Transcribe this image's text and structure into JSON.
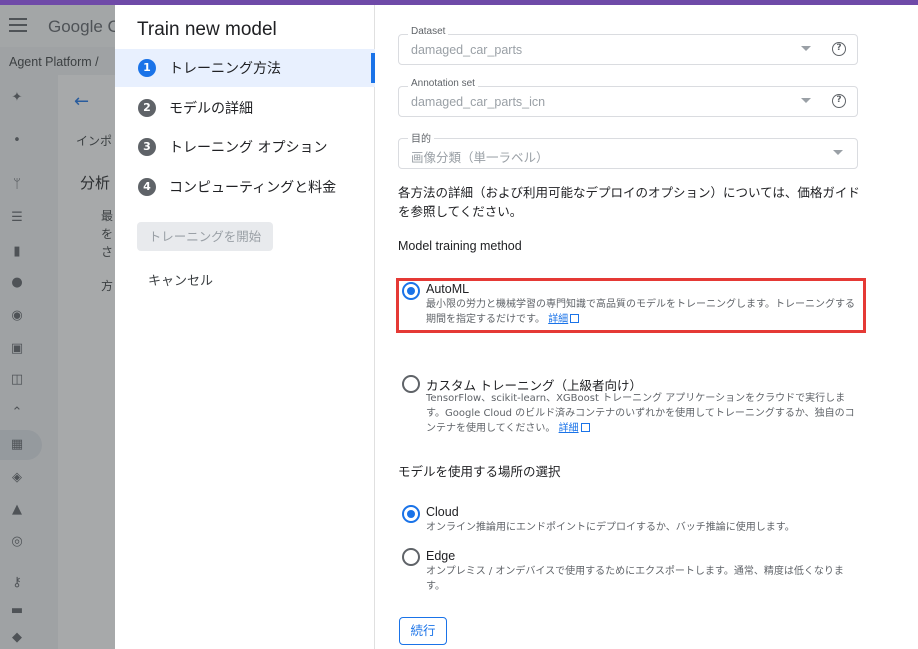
{
  "background": {
    "logo": "Google C",
    "breadcrumb": "Agent Platform  /",
    "tab_partial": "インポ",
    "title_partial": "分析",
    "text_partial": [
      "最",
      "を",
      "さ",
      "方"
    ]
  },
  "dialog": {
    "title": "Train new model",
    "steps": [
      {
        "num": "1",
        "label": "トレーニング方法"
      },
      {
        "num": "2",
        "label": "モデルの詳細"
      },
      {
        "num": "3",
        "label": "トレーニング オプション"
      },
      {
        "num": "4",
        "label": "コンピューティングと料金"
      }
    ],
    "start_label": "トレーニングを開始",
    "cancel_label": "キャンセル"
  },
  "form": {
    "dataset": {
      "label": "Dataset",
      "value": "damaged_car_parts"
    },
    "annotation": {
      "label": "Annotation set",
      "value": "damaged_car_parts_icn"
    },
    "objective": {
      "label": "目的",
      "value": "画像分類（単一ラベル）"
    },
    "description": "各方法の詳細（および利用可能なデプロイのオプション）については、価格ガイドを参照してください。",
    "method_heading": "Model training method",
    "automl": {
      "title": "AutoML",
      "desc": "最小限の労力と機械学習の専門知識で高品質のモデルをトレーニングします。トレーニングする期間を指定するだけです。",
      "link": "詳細"
    },
    "custom": {
      "title": "カスタム トレーニング（上級者向け）",
      "desc": "TensorFlow、scikit-learn、XGBoost トレーニング アプリケーションをクラウドで実行します。Google Cloud のビルド済みコンテナのいずれかを使用してトレーニングするか、独自のコンテナを使用してください。",
      "link": "詳細"
    },
    "location_heading": "モデルを使用する場所の選択",
    "cloud": {
      "title": "Cloud",
      "desc": "オンライン推論用にエンドポイントにデプロイするか、バッチ推論に使用します。"
    },
    "edge": {
      "title": "Edge",
      "desc": "オンプレミス / オンデバイスで使用するためにエクスポートします。通常、精度は低くなります。"
    },
    "continue_label": "続行"
  },
  "colors": {
    "accent": "#1a73e8",
    "highlight": "#e53935",
    "topbar": "#6f4aa8"
  }
}
